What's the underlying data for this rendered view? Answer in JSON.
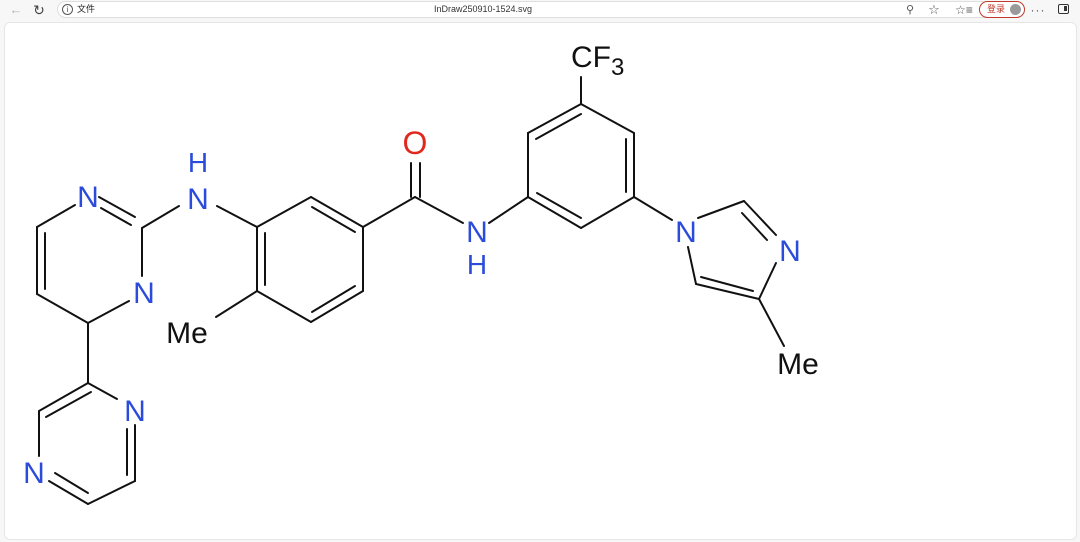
{
  "browser": {
    "site_info_label": "文件",
    "url": "InDraw250910-1524.svg",
    "login_label": "登录",
    "more_label": "···"
  },
  "icons": [
    "back-icon",
    "reload-icon",
    "info-icon",
    "zoom-icon",
    "star-icon",
    "favorites-icon",
    "avatar-icon",
    "more-icon",
    "sidebar-toggle-icon"
  ],
  "molecule": {
    "labels": {
      "cf3_main": "CF",
      "cf3_sub": "3",
      "carbonyl_o": "O",
      "amine_h": "H",
      "amine_n": "N",
      "amide_n": "N",
      "amide_h": "H",
      "pyrimidine_n1": "N",
      "pyrimidine_n3": "N",
      "pyrazine_n1": "N",
      "pyrazine_n4": "N",
      "imidazole_n1": "N",
      "imidazole_n3": "N",
      "methyl_benzene": "Me",
      "methyl_imidazole": "Me"
    },
    "colors": {
      "bond": "#111111",
      "nitrogen": "#2b4bdc",
      "oxygen": "#e0281e",
      "carbon_label": "#111111"
    }
  }
}
